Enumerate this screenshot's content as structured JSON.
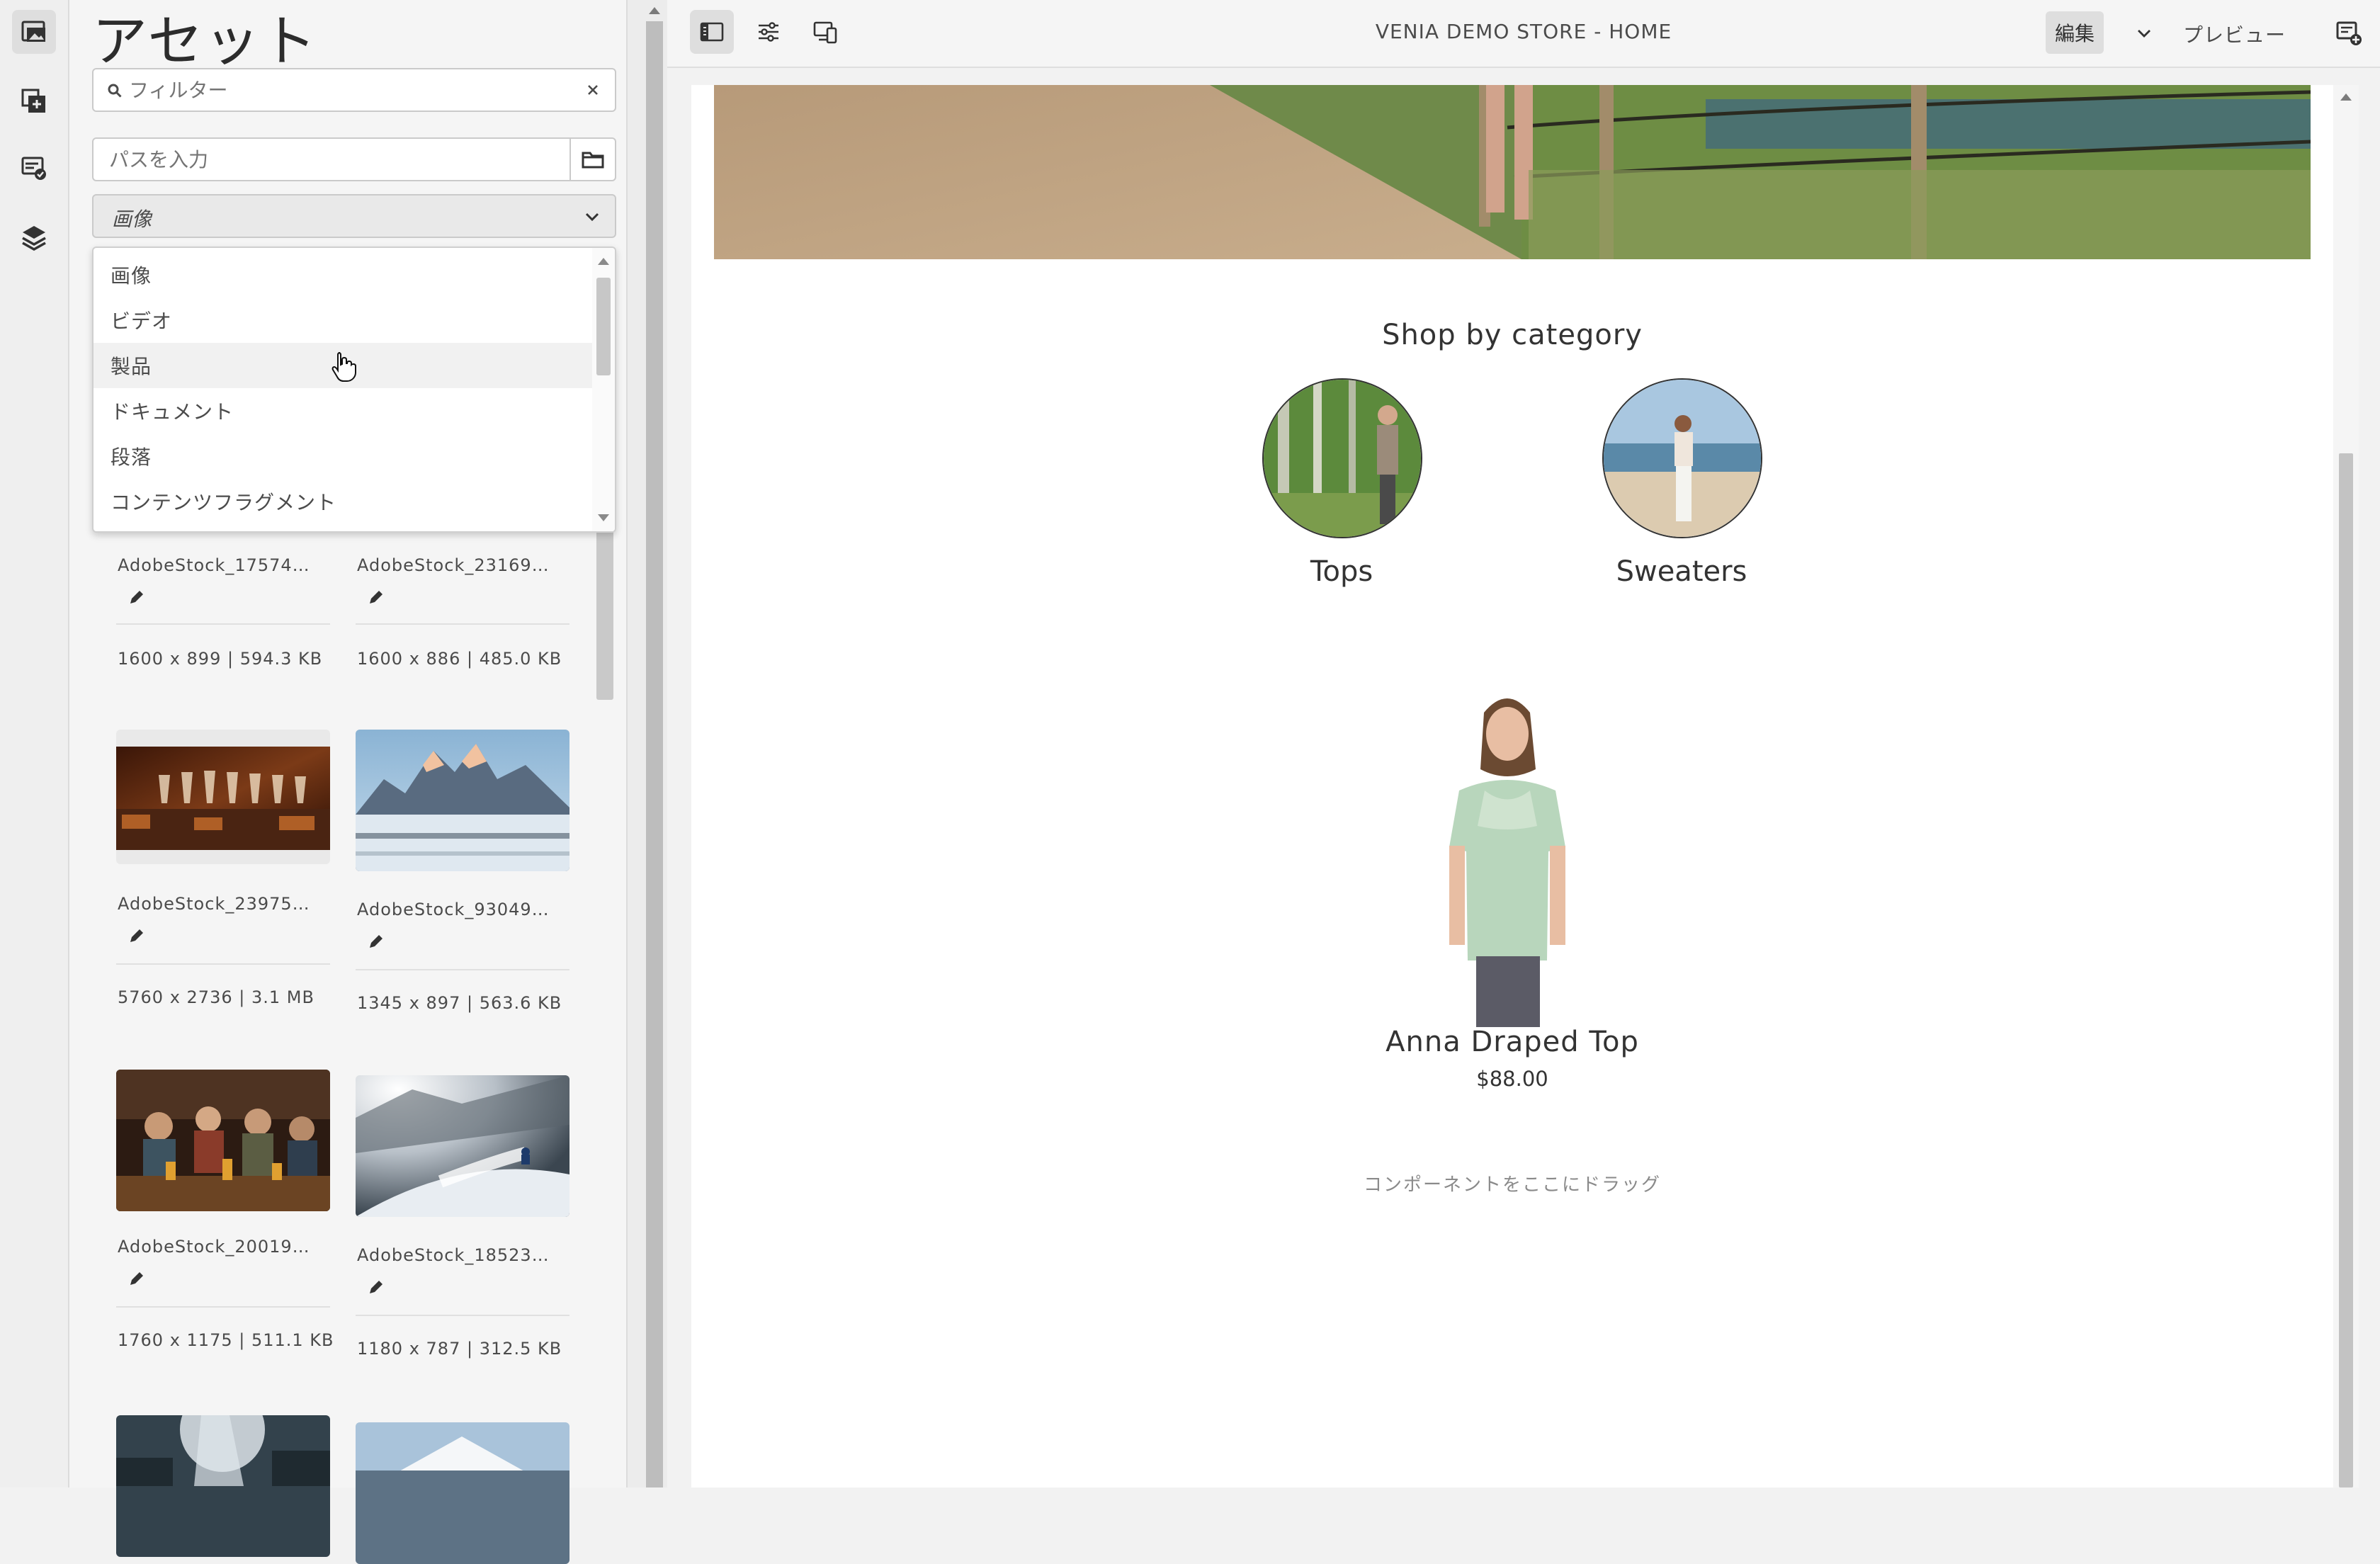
{
  "panel": {
    "title": "アセット",
    "search": {
      "placeholder": "フィルター",
      "value": ""
    },
    "path": {
      "placeholder": "パスを入力",
      "value": ""
    },
    "type_select": {
      "selected": "画像"
    },
    "dropdown": {
      "options": [
        "画像",
        "ビデオ",
        "製品",
        "ドキュメント",
        "段落",
        "コンテンツフラグメント"
      ],
      "hovered_index": 2
    },
    "assets": [
      {
        "name": "AdobeStock_17574…",
        "meta": "1600 x 899 | 594.3 KB"
      },
      {
        "name": "AdobeStock_23169…",
        "meta": "1600 x 886 | 485.0 KB"
      },
      {
        "name": "AdobeStock_23975…",
        "meta": "5760 x 2736 | 3.1 MB"
      },
      {
        "name": "AdobeStock_93049…",
        "meta": "1345 x 897 | 563.6 KB"
      },
      {
        "name": "AdobeStock_20019…",
        "meta": "1760 x 1175 | 511.1 KB"
      },
      {
        "name": "AdobeStock_18523…",
        "meta": "1180 x 787 | 312.5 KB"
      }
    ]
  },
  "rail": {
    "items": [
      "assets-icon",
      "components-icon",
      "content-tree-icon",
      "layers-icon"
    ],
    "active_index": 0
  },
  "toolbar": {
    "page_title": "VENIA DEMO STORE - HOME",
    "mode_label": "編集",
    "preview_label": "プレビュー",
    "icons": [
      "side-panel-icon",
      "page-properties-icon",
      "emulator-icon",
      "annotations-icon"
    ]
  },
  "page": {
    "shop_heading": "Shop by category",
    "categories": [
      {
        "label": "Tops"
      },
      {
        "label": "Sweaters"
      }
    ],
    "product": {
      "name": "Anna Draped Top",
      "price": "$88.00"
    },
    "drop_zone": "コンポーネントをここにドラッグ"
  },
  "colors": {
    "toolbar_bg": "#f5f5f5",
    "panel_bg": "#f5f5f5",
    "selected_bg": "#dedede",
    "text": "#323232"
  }
}
